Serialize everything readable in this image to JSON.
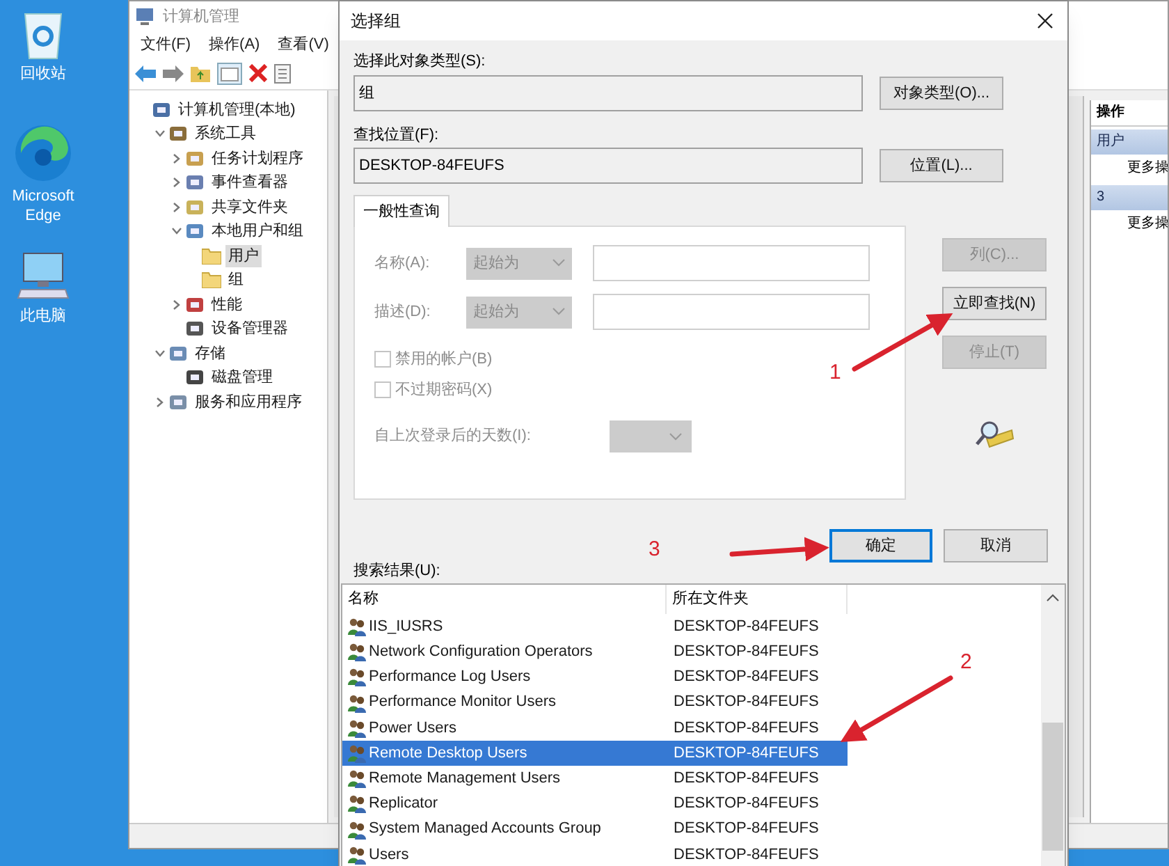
{
  "desktop_icons": [
    {
      "label": "回收站"
    },
    {
      "label": "Microsoft Edge"
    },
    {
      "label": "此电脑"
    }
  ],
  "window": {
    "title": "计算机管理",
    "menu": [
      "文件(F)",
      "操作(A)",
      "查看(V)"
    ],
    "tree": [
      {
        "label": "计算机管理(本地)",
        "selected": false,
        "children": [
          {
            "label": "系统工具",
            "expanded": true,
            "selected": false,
            "children": [
              {
                "label": "任务计划程序",
                "expanded": false,
                "selected": false
              },
              {
                "label": "事件查看器",
                "expanded": false,
                "selected": false
              },
              {
                "label": "共享文件夹",
                "expanded": false,
                "selected": false
              },
              {
                "label": "本地用户和组",
                "expanded": true,
                "selected": false,
                "children": [
                  {
                    "label": "用户",
                    "selected": true
                  },
                  {
                    "label": "组",
                    "selected": false
                  }
                ]
              },
              {
                "label": "性能",
                "expanded": false,
                "selected": false
              },
              {
                "label": "设备管理器",
                "selected": false
              }
            ]
          },
          {
            "label": "存储",
            "expanded": true,
            "selected": false,
            "children": [
              {
                "label": "磁盘管理",
                "selected": false
              }
            ]
          },
          {
            "label": "服务和应用程序",
            "expanded": false,
            "selected": false
          }
        ]
      }
    ],
    "actions": {
      "header": "操作",
      "sections": [
        {
          "title": "用户",
          "items": [
            "更多操"
          ]
        },
        {
          "title": "3",
          "items": [
            "更多操"
          ]
        }
      ]
    }
  },
  "dialog": {
    "title": "选择组",
    "object_type_label": "选择此对象类型(S):",
    "object_type": "组",
    "object_type_button": "对象类型(O)...",
    "location_label": "查找位置(F):",
    "location": "DESKTOP-84FEUFS",
    "location_button": "位置(L)...",
    "tabs": [
      {
        "label": "一般性查询",
        "selected": true
      }
    ],
    "query": {
      "disabled": true,
      "fields": [
        {
          "label": "名称(A):",
          "operator": "起始为"
        },
        {
          "label": "描述(D):",
          "operator": "起始为"
        }
      ],
      "checkboxes": [
        {
          "label": "禁用的帐户(B)",
          "checked": false
        },
        {
          "label": "不过期密码(X)",
          "checked": false
        }
      ],
      "days_label": "自上次登录后的天数(I):"
    },
    "side_buttons": [
      {
        "label": "列(C)...",
        "disabled": true
      },
      {
        "label": "立即查找(N)",
        "disabled": false
      },
      {
        "label": "停止(T)",
        "disabled": true
      }
    ],
    "ok_button": {
      "label": "确定",
      "focused": true
    },
    "cancel_button": "取消",
    "results_label": "搜索结果(U):",
    "results": {
      "columns": [
        "名称",
        "所在文件夹"
      ],
      "rows": [
        {
          "name": "IIS_IUSRS",
          "folder": "DESKTOP-84FEUFS",
          "selected": false
        },
        {
          "name": "Network Configuration Operators",
          "folder": "DESKTOP-84FEUFS",
          "selected": false
        },
        {
          "name": "Performance Log Users",
          "folder": "DESKTOP-84FEUFS",
          "selected": false
        },
        {
          "name": "Performance Monitor Users",
          "folder": "DESKTOP-84FEUFS",
          "selected": false
        },
        {
          "name": "Power Users",
          "folder": "DESKTOP-84FEUFS",
          "selected": false
        },
        {
          "name": "Remote Desktop Users",
          "folder": "DESKTOP-84FEUFS",
          "selected": true
        },
        {
          "name": "Remote Management Users",
          "folder": "DESKTOP-84FEUFS",
          "selected": false
        },
        {
          "name": "Replicator",
          "folder": "DESKTOP-84FEUFS",
          "selected": false
        },
        {
          "name": "System Managed Accounts Group",
          "folder": "DESKTOP-84FEUFS",
          "selected": false
        },
        {
          "name": "Users",
          "folder": "DESKTOP-84FEUFS",
          "selected": false
        }
      ]
    }
  },
  "annotations": [
    {
      "label": "1"
    },
    {
      "label": "2"
    },
    {
      "label": "3"
    }
  ]
}
